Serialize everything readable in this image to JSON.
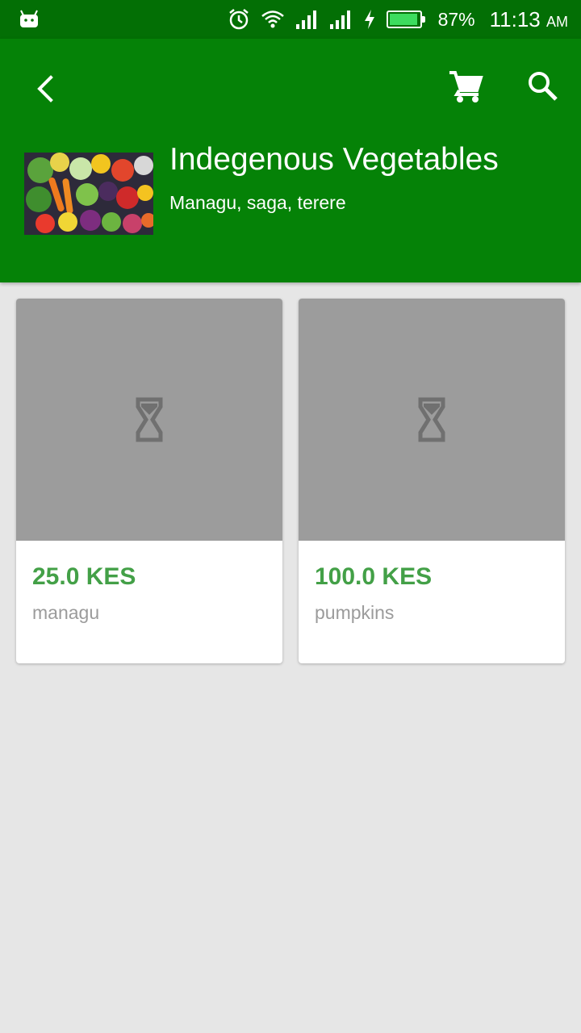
{
  "status_bar": {
    "battery": "87%",
    "time": "11:13",
    "ampm": "AM",
    "icons": [
      "android-icon",
      "alarm-icon",
      "wifi-icon",
      "signal-icon",
      "signal-icon",
      "charging-icon",
      "battery-icon"
    ]
  },
  "toolbar": {
    "icons": [
      "back-arrow-icon",
      "cart-icon",
      "search-icon"
    ]
  },
  "category": {
    "title": "Indegenous Vegetables",
    "subtitle": "Managu, saga, terere"
  },
  "products": [
    {
      "price": "25.0 KES",
      "name": "managu"
    },
    {
      "price": "100.0 KES",
      "name": "pumpkins"
    }
  ],
  "colors": {
    "status_bar": "#036f05",
    "app_bar": "#058207",
    "price": "#43a047",
    "placeholder": "#9c9c9c",
    "background": "#e6e6e6"
  }
}
